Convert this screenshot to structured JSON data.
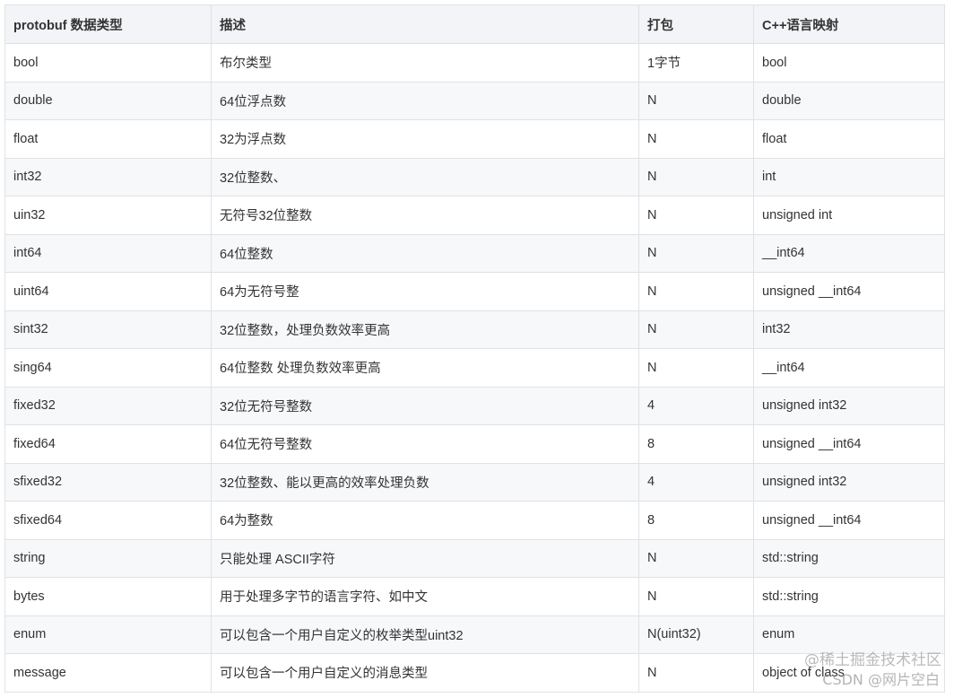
{
  "table": {
    "headers": [
      "protobuf 数据类型",
      "描述",
      "打包",
      "C++语言映射"
    ],
    "rows": [
      [
        "bool",
        "布尔类型",
        "1字节",
        "bool"
      ],
      [
        "double",
        "64位浮点数",
        "N",
        "double"
      ],
      [
        "float",
        "32为浮点数",
        "N",
        "float"
      ],
      [
        "int32",
        "32位整数、",
        "N",
        "int"
      ],
      [
        "uin32",
        "无符号32位整数",
        "N",
        "unsigned int"
      ],
      [
        "int64",
        "64位整数",
        "N",
        "__int64"
      ],
      [
        "uint64",
        "64为无符号整",
        "N",
        "unsigned __int64"
      ],
      [
        "sint32",
        "32位整数，处理负数效率更高",
        "N",
        "int32"
      ],
      [
        "sing64",
        "64位整数 处理负数效率更高",
        "N",
        "__int64"
      ],
      [
        "fixed32",
        "32位无符号整数",
        "4",
        "unsigned int32"
      ],
      [
        "fixed64",
        "64位无符号整数",
        "8",
        "unsigned __int64"
      ],
      [
        "sfixed32",
        "32位整数、能以更高的效率处理负数",
        "4",
        "unsigned int32"
      ],
      [
        "sfixed64",
        "64为整数",
        "8",
        "unsigned __int64"
      ],
      [
        "string",
        "只能处理 ASCII字符",
        "N",
        "std::string"
      ],
      [
        "bytes",
        "用于处理多字节的语言字符、如中文",
        "N",
        "std::string"
      ],
      [
        "enum",
        "可以包含一个用户自定义的枚举类型uint32",
        "N(uint32)",
        "enum"
      ],
      [
        "message",
        "可以包含一个用户自定义的消息类型",
        "N",
        "object of class"
      ]
    ]
  },
  "watermarks": {
    "line1": "@稀土掘金技术社区",
    "line2": "CSDN @网片空白"
  }
}
